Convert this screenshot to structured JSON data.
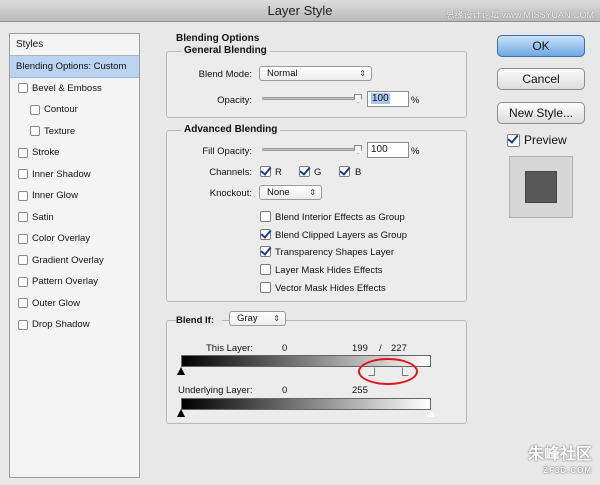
{
  "window": {
    "title": "Layer Style",
    "watermark_top": "思缘设计论坛 www.MISSYUAN.COM"
  },
  "styles_panel": {
    "header": "Styles",
    "items": [
      {
        "label": "Blending Options: Custom",
        "selected": true,
        "indent": false,
        "checkbox": false
      },
      {
        "label": "Bevel & Emboss",
        "indent": false,
        "checkbox": true
      },
      {
        "label": "Contour",
        "indent": true,
        "checkbox": true
      },
      {
        "label": "Texture",
        "indent": true,
        "checkbox": true
      },
      {
        "label": "Stroke",
        "indent": false,
        "checkbox": true
      },
      {
        "label": "Inner Shadow",
        "indent": false,
        "checkbox": true
      },
      {
        "label": "Inner Glow",
        "indent": false,
        "checkbox": true
      },
      {
        "label": "Satin",
        "indent": false,
        "checkbox": true
      },
      {
        "label": "Color Overlay",
        "indent": false,
        "checkbox": true
      },
      {
        "label": "Gradient Overlay",
        "indent": false,
        "checkbox": true
      },
      {
        "label": "Pattern Overlay",
        "indent": false,
        "checkbox": true
      },
      {
        "label": "Outer Glow",
        "indent": false,
        "checkbox": true
      },
      {
        "label": "Drop Shadow",
        "indent": false,
        "checkbox": true
      }
    ]
  },
  "blending": {
    "title": "Blending Options",
    "general": {
      "label": "General Blending",
      "blend_mode_label": "Blend Mode:",
      "blend_mode": "Normal",
      "opacity_label": "Opacity:",
      "opacity": "100",
      "opacity_unit": "%"
    },
    "advanced": {
      "label": "Advanced Blending",
      "fill_opacity_label": "Fill Opacity:",
      "fill_opacity": "100",
      "fill_unit": "%",
      "channels_label": "Channels:",
      "channels": [
        {
          "label": "R",
          "checked": true
        },
        {
          "label": "G",
          "checked": true
        },
        {
          "label": "B",
          "checked": true
        }
      ],
      "knockout_label": "Knockout:",
      "knockout": "None",
      "options": [
        {
          "label": "Blend Interior Effects as Group",
          "checked": false
        },
        {
          "label": "Blend Clipped Layers as Group",
          "checked": true
        },
        {
          "label": "Transparency Shapes Layer",
          "checked": true
        },
        {
          "label": "Layer Mask Hides Effects",
          "checked": false
        },
        {
          "label": "Vector Mask Hides Effects",
          "checked": false
        }
      ]
    },
    "blend_if": {
      "label": "Blend If:",
      "channel": "Gray",
      "this_layer_label": "This Layer:",
      "this_layer_low": "0",
      "this_layer_high_a": "199",
      "this_layer_sep": "/",
      "this_layer_high_b": "227",
      "underlying_label": "Underlying Layer:",
      "underlying_low": "0",
      "underlying_high": "255"
    }
  },
  "buttons": {
    "ok": "OK",
    "cancel": "Cancel",
    "new_style": "New Style..."
  },
  "preview": {
    "label": "Preview",
    "checked": true
  },
  "watermark_bottom": {
    "main": "朱峰社区",
    "sub": "ZF3D.COM"
  },
  "colors": {
    "accent": "#6fa6e2",
    "selection": "#b9d3f0",
    "annotation": "#e2141a",
    "check": "#1b3c8f"
  }
}
